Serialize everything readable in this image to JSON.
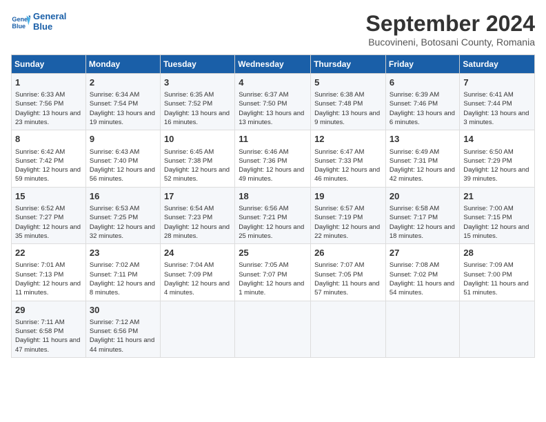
{
  "header": {
    "logo_line1": "General",
    "logo_line2": "Blue",
    "month_title": "September 2024",
    "subtitle": "Bucovineni, Botosani County, Romania"
  },
  "days_of_week": [
    "Sunday",
    "Monday",
    "Tuesday",
    "Wednesday",
    "Thursday",
    "Friday",
    "Saturday"
  ],
  "weeks": [
    [
      {
        "day": "1",
        "info": "Sunrise: 6:33 AM\nSunset: 7:56 PM\nDaylight: 13 hours and 23 minutes."
      },
      {
        "day": "2",
        "info": "Sunrise: 6:34 AM\nSunset: 7:54 PM\nDaylight: 13 hours and 19 minutes."
      },
      {
        "day": "3",
        "info": "Sunrise: 6:35 AM\nSunset: 7:52 PM\nDaylight: 13 hours and 16 minutes."
      },
      {
        "day": "4",
        "info": "Sunrise: 6:37 AM\nSunset: 7:50 PM\nDaylight: 13 hours and 13 minutes."
      },
      {
        "day": "5",
        "info": "Sunrise: 6:38 AM\nSunset: 7:48 PM\nDaylight: 13 hours and 9 minutes."
      },
      {
        "day": "6",
        "info": "Sunrise: 6:39 AM\nSunset: 7:46 PM\nDaylight: 13 hours and 6 minutes."
      },
      {
        "day": "7",
        "info": "Sunrise: 6:41 AM\nSunset: 7:44 PM\nDaylight: 13 hours and 3 minutes."
      }
    ],
    [
      {
        "day": "8",
        "info": "Sunrise: 6:42 AM\nSunset: 7:42 PM\nDaylight: 12 hours and 59 minutes."
      },
      {
        "day": "9",
        "info": "Sunrise: 6:43 AM\nSunset: 7:40 PM\nDaylight: 12 hours and 56 minutes."
      },
      {
        "day": "10",
        "info": "Sunrise: 6:45 AM\nSunset: 7:38 PM\nDaylight: 12 hours and 52 minutes."
      },
      {
        "day": "11",
        "info": "Sunrise: 6:46 AM\nSunset: 7:36 PM\nDaylight: 12 hours and 49 minutes."
      },
      {
        "day": "12",
        "info": "Sunrise: 6:47 AM\nSunset: 7:33 PM\nDaylight: 12 hours and 46 minutes."
      },
      {
        "day": "13",
        "info": "Sunrise: 6:49 AM\nSunset: 7:31 PM\nDaylight: 12 hours and 42 minutes."
      },
      {
        "day": "14",
        "info": "Sunrise: 6:50 AM\nSunset: 7:29 PM\nDaylight: 12 hours and 39 minutes."
      }
    ],
    [
      {
        "day": "15",
        "info": "Sunrise: 6:52 AM\nSunset: 7:27 PM\nDaylight: 12 hours and 35 minutes."
      },
      {
        "day": "16",
        "info": "Sunrise: 6:53 AM\nSunset: 7:25 PM\nDaylight: 12 hours and 32 minutes."
      },
      {
        "day": "17",
        "info": "Sunrise: 6:54 AM\nSunset: 7:23 PM\nDaylight: 12 hours and 28 minutes."
      },
      {
        "day": "18",
        "info": "Sunrise: 6:56 AM\nSunset: 7:21 PM\nDaylight: 12 hours and 25 minutes."
      },
      {
        "day": "19",
        "info": "Sunrise: 6:57 AM\nSunset: 7:19 PM\nDaylight: 12 hours and 22 minutes."
      },
      {
        "day": "20",
        "info": "Sunrise: 6:58 AM\nSunset: 7:17 PM\nDaylight: 12 hours and 18 minutes."
      },
      {
        "day": "21",
        "info": "Sunrise: 7:00 AM\nSunset: 7:15 PM\nDaylight: 12 hours and 15 minutes."
      }
    ],
    [
      {
        "day": "22",
        "info": "Sunrise: 7:01 AM\nSunset: 7:13 PM\nDaylight: 12 hours and 11 minutes."
      },
      {
        "day": "23",
        "info": "Sunrise: 7:02 AM\nSunset: 7:11 PM\nDaylight: 12 hours and 8 minutes."
      },
      {
        "day": "24",
        "info": "Sunrise: 7:04 AM\nSunset: 7:09 PM\nDaylight: 12 hours and 4 minutes."
      },
      {
        "day": "25",
        "info": "Sunrise: 7:05 AM\nSunset: 7:07 PM\nDaylight: 12 hours and 1 minute."
      },
      {
        "day": "26",
        "info": "Sunrise: 7:07 AM\nSunset: 7:05 PM\nDaylight: 11 hours and 57 minutes."
      },
      {
        "day": "27",
        "info": "Sunrise: 7:08 AM\nSunset: 7:02 PM\nDaylight: 11 hours and 54 minutes."
      },
      {
        "day": "28",
        "info": "Sunrise: 7:09 AM\nSunset: 7:00 PM\nDaylight: 11 hours and 51 minutes."
      }
    ],
    [
      {
        "day": "29",
        "info": "Sunrise: 7:11 AM\nSunset: 6:58 PM\nDaylight: 11 hours and 47 minutes."
      },
      {
        "day": "30",
        "info": "Sunrise: 7:12 AM\nSunset: 6:56 PM\nDaylight: 11 hours and 44 minutes."
      },
      null,
      null,
      null,
      null,
      null
    ]
  ]
}
